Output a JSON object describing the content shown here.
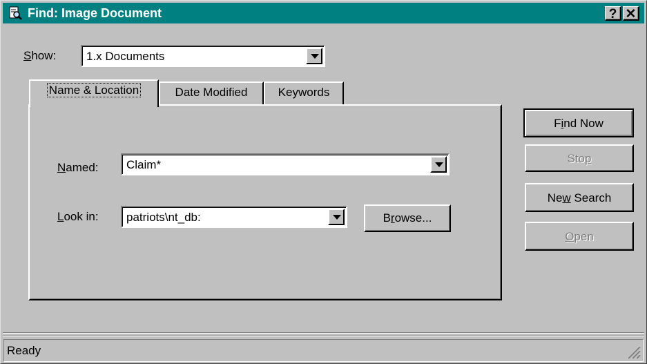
{
  "window": {
    "title": "Find: Image Document",
    "help_label": "?",
    "close_label": "✕"
  },
  "show": {
    "label": "Show:",
    "accel": "S",
    "label_rest": "how:",
    "value": "1.x Documents"
  },
  "tabs": [
    {
      "label": "Name & Location",
      "active": true
    },
    {
      "label": "Date Modified",
      "active": false
    },
    {
      "label": "Keywords",
      "active": false
    }
  ],
  "named": {
    "accel": "N",
    "label_rest": "amed:",
    "value": "Claim*"
  },
  "look_in": {
    "accel": "L",
    "label_rest": "ook in:",
    "value": "patriots\\nt_db:"
  },
  "browse": {
    "pre": "B",
    "accel": "r",
    "post": "owse..."
  },
  "buttons": {
    "find_now": {
      "pre": "F",
      "accel": "i",
      "post": "nd Now",
      "enabled": true
    },
    "stop": {
      "pre": "Sto",
      "accel": "p",
      "post": "",
      "enabled": false
    },
    "new_search": {
      "pre": "Ne",
      "accel": "w",
      "post": " Search",
      "enabled": true
    },
    "open": {
      "pre": "",
      "accel": "O",
      "post": "pen",
      "enabled": false
    }
  },
  "status": {
    "text": "Ready"
  },
  "icons": {
    "title": "find-document-icon",
    "grip": "resize-grip-icon"
  },
  "colors": {
    "titlebar": "#008080",
    "face": "#c0c0c0"
  }
}
